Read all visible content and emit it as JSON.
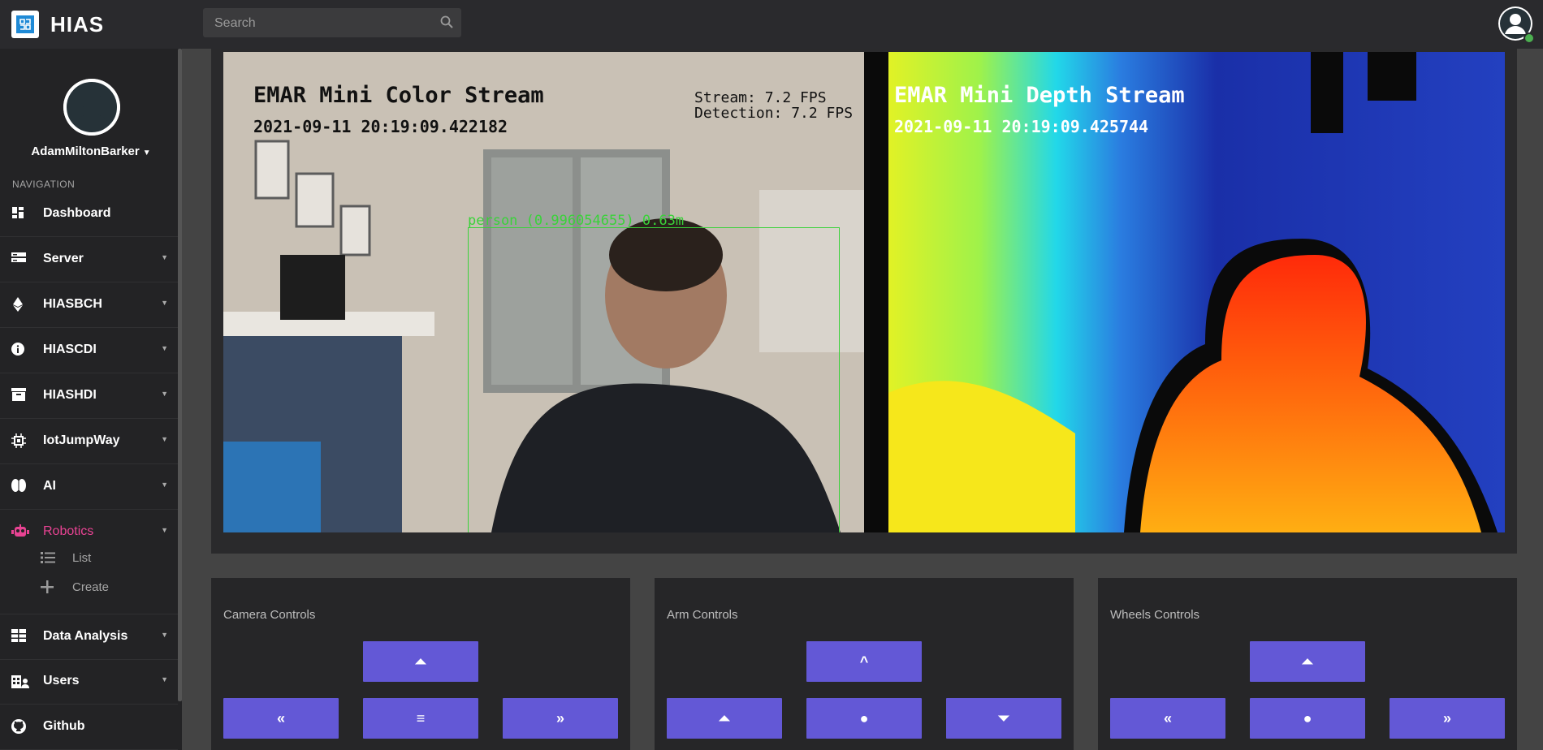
{
  "app": {
    "brand": "HIAS"
  },
  "search": {
    "placeholder": "Search"
  },
  "profile": {
    "username": "AdamMiltonBarker"
  },
  "sidebar": {
    "heading": "NAVIGATION",
    "items": [
      {
        "label": "Dashboard",
        "icon": "dashboard-icon"
      },
      {
        "label": "Server",
        "icon": "server-icon"
      },
      {
        "label": "HIASBCH",
        "icon": "ethereum-icon"
      },
      {
        "label": "HIASCDI",
        "icon": "info-icon"
      },
      {
        "label": "HIASHDI",
        "icon": "archive-icon"
      },
      {
        "label": "IotJumpWay",
        "icon": "chip-icon"
      },
      {
        "label": "AI",
        "icon": "brain-icon"
      },
      {
        "label": "Robotics",
        "icon": "robot-icon",
        "active": true
      },
      {
        "label": "Data Analysis",
        "icon": "table-icon"
      },
      {
        "label": "Users",
        "icon": "users-icon"
      },
      {
        "label": "Github",
        "icon": "github-icon"
      }
    ],
    "robotics_sub": [
      {
        "label": "List",
        "icon": "list-icon"
      },
      {
        "label": "Create",
        "icon": "plus-icon"
      }
    ]
  },
  "streams": {
    "color": {
      "title": "EMAR Mini Color Stream",
      "timestamp": "2021-09-11 20:19:09.422182",
      "fps_stream": "Stream: 7.2 FPS",
      "fps_detection": "Detection: 7.2 FPS",
      "detection_label": "person (0.996054655) 0.63m"
    },
    "depth": {
      "title": "EMAR Mini Depth Stream",
      "timestamp": "2021-09-11 20:19:09.425744"
    }
  },
  "controls": {
    "camera": {
      "title": "Camera Controls",
      "buttons": [
        "⏶",
        "«",
        "≡",
        "»"
      ]
    },
    "arm": {
      "title": "Arm Controls",
      "buttons": [
        "^",
        "⏶",
        "●",
        "⏷"
      ]
    },
    "wheels": {
      "title": "Wheels Controls",
      "buttons": [
        "⏶",
        "«",
        "●",
        "»"
      ]
    }
  },
  "colors": {
    "accent": "#6358d6",
    "active_nav": "#e84393",
    "detection": "#3ad23a"
  }
}
